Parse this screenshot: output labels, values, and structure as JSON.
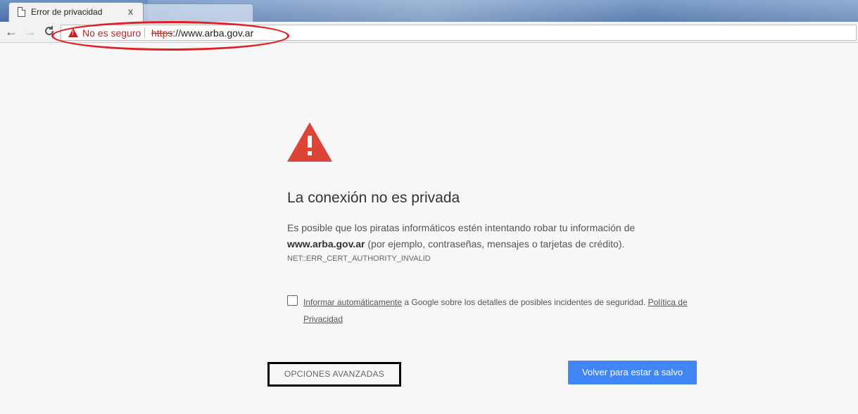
{
  "tab": {
    "title": "Error de privacidad",
    "close": "x"
  },
  "toolbar": {
    "back": "←",
    "forward": "→",
    "reload": "C"
  },
  "omnibox": {
    "security_label": "No es seguro",
    "url_scheme": "https",
    "url_rest": "://www.arba.gov.ar"
  },
  "interstitial": {
    "heading": "La conexión no es privada",
    "body_intro": "Es posible que los piratas informáticos estén intentando robar tu información de ",
    "body_domain": "www.arba.gov.ar",
    "body_rest": " (por ejemplo, contraseñas, mensajes o tarjetas de crédito).",
    "error_code": "NET::ERR_CERT_AUTHORITY_INVALID",
    "report_link": "Informar automáticamente",
    "report_text": " a Google sobre los detalles de posibles incidentes de seguridad. ",
    "privacy_link": "Política de Privacidad",
    "advanced_button": "OPCIONES AVANZADAS",
    "back_to_safety_button": "Volver para estar a salvo"
  },
  "colors": {
    "warning_red": "#db4437",
    "primary_blue": "#4285f4",
    "annotation_red": "#e01e24"
  }
}
